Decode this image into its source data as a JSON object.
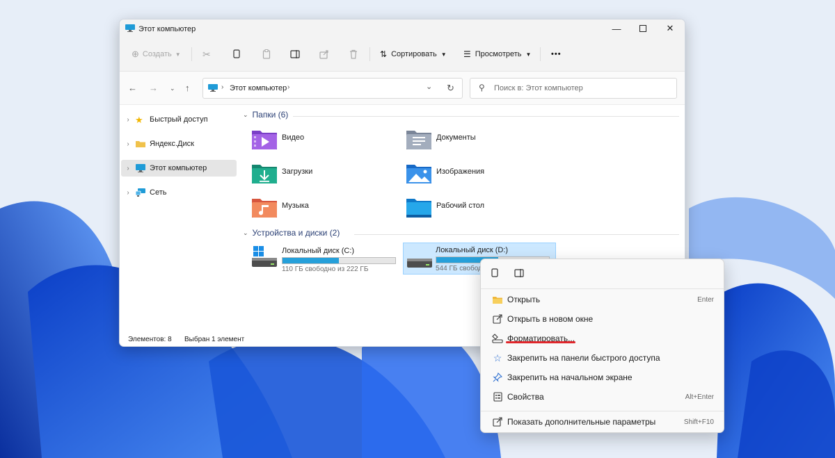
{
  "window": {
    "title": "Этот компьютер",
    "minimize_icon": "minimize-icon",
    "maximize_icon": "maximize-icon",
    "close_icon": "close-icon"
  },
  "toolbar": {
    "create_label": "Создать",
    "sort_label": "Сортировать",
    "view_label": "Просмотреть",
    "more_label": "•••"
  },
  "address": {
    "path_label": "Этот компьютер",
    "search_placeholder": "Поиск в: Этот компьютер"
  },
  "sidebar": {
    "items": [
      {
        "label": "Быстрый доступ",
        "icon": "star-icon"
      },
      {
        "label": "Яндекс.Диск",
        "icon": "folder-icon"
      },
      {
        "label": "Этот компьютер",
        "icon": "computer-icon"
      },
      {
        "label": "Сеть",
        "icon": "network-icon"
      }
    ]
  },
  "folders_section": {
    "title": "Папки (6)",
    "items": [
      {
        "label": "Видео",
        "icon": "video-folder-icon"
      },
      {
        "label": "Документы",
        "icon": "documents-folder-icon"
      },
      {
        "label": "Загрузки",
        "icon": "downloads-folder-icon"
      },
      {
        "label": "Изображения",
        "icon": "pictures-folder-icon"
      },
      {
        "label": "Музыка",
        "icon": "music-folder-icon"
      },
      {
        "label": "Рабочий стол",
        "icon": "desktop-folder-icon"
      }
    ]
  },
  "drives_section": {
    "title": "Устройства и диски (2)",
    "drives": [
      {
        "label": "Локальный диск (C:)",
        "free": "110 ГБ свободно из 222 ГБ",
        "used_fraction": 0.5
      },
      {
        "label": "Локальный диск (D:)",
        "free": "544 ГБ свободно",
        "used_fraction": 0.55
      }
    ]
  },
  "status": {
    "items_count": "Элементов: 8",
    "selected": "Выбран 1 элемент"
  },
  "context_menu": {
    "items": [
      {
        "label": "Открыть",
        "shortcut": "Enter",
        "icon": "folder-open-icon"
      },
      {
        "label": "Открыть в новом окне",
        "shortcut": "",
        "icon": "open-new-window-icon"
      },
      {
        "label": "Форматировать...",
        "shortcut": "",
        "icon": "format-drive-icon"
      },
      {
        "label": "Закрепить на панели быстрого доступа",
        "shortcut": "",
        "icon": "star-outline-icon"
      },
      {
        "label": "Закрепить на начальном экране",
        "shortcut": "",
        "icon": "pin-icon"
      },
      {
        "label": "Свойства",
        "shortcut": "Alt+Enter",
        "icon": "properties-icon"
      },
      {
        "label": "Показать дополнительные параметры",
        "shortcut": "Shift+F10",
        "icon": "more-options-icon"
      }
    ]
  },
  "colors": {
    "accent": "#0067c0",
    "selection": "#cce8ff",
    "drive_bar": "#26a0da",
    "highlight_underline": "#e0262b"
  }
}
